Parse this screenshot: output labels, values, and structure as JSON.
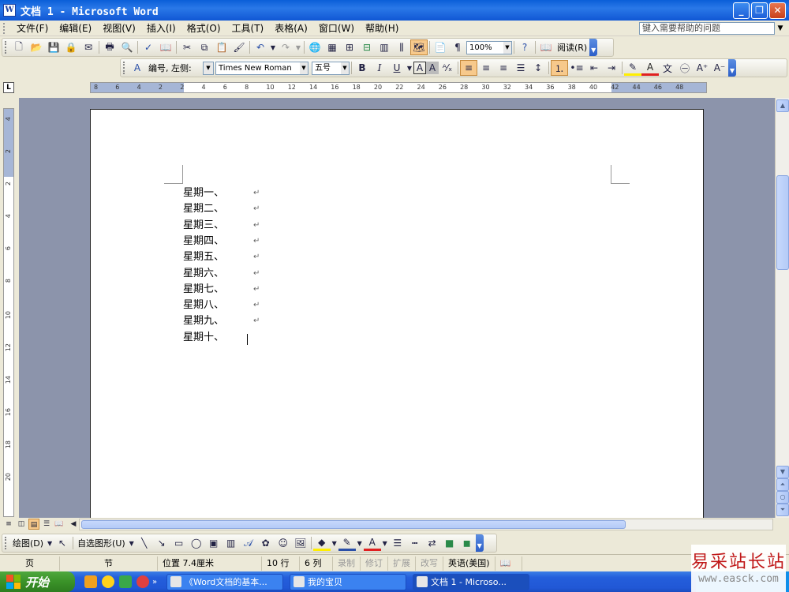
{
  "window": {
    "title": "文档 1 - Microsoft Word",
    "minimize": "_",
    "restore": "❐",
    "close": "✕"
  },
  "menu": {
    "items": [
      "文件(F)",
      "编辑(E)",
      "视图(V)",
      "插入(I)",
      "格式(O)",
      "工具(T)",
      "表格(A)",
      "窗口(W)",
      "帮助(H)"
    ],
    "help_placeholder": "键入需要帮助的问题"
  },
  "standard_toolbar": {
    "zoom": "100%",
    "read_label": "阅读(R)"
  },
  "format_toolbar": {
    "style": "编号, 左侧:",
    "font": "Times New Roman",
    "size": "五号"
  },
  "ruler": {
    "ticks": [
      "8",
      "6",
      "4",
      "2",
      "2",
      "4",
      "6",
      "8",
      "10",
      "12",
      "14",
      "16",
      "18",
      "20",
      "22",
      "24",
      "26",
      "28",
      "30",
      "32",
      "34",
      "36",
      "38",
      "40",
      "42",
      "44",
      "46",
      "48"
    ]
  },
  "vertical_ruler": {
    "ticks": [
      "4",
      "2",
      "2",
      "4",
      "6",
      "8",
      "10",
      "12",
      "14",
      "16",
      "18",
      "20"
    ]
  },
  "document": {
    "lines": [
      "星期一、",
      "星期二、",
      "星期三、",
      "星期四、",
      "星期五、",
      "星期六、",
      "星期七、",
      "星期八、",
      "星期九、",
      "星期十、"
    ],
    "paragraph_mark": "↵"
  },
  "drawing_toolbar": {
    "draw_label": "绘图(D)",
    "autoshape_label": "自选图形(U)"
  },
  "status": {
    "page": "页",
    "section": "节",
    "position": "位置 7.4厘米",
    "line": "10 行",
    "column": "6 列",
    "rec": "录制",
    "trk": "修订",
    "ext": "扩展",
    "ovr": "改写",
    "language": "英语(美国)"
  },
  "taskbar": {
    "start": "开始",
    "tasks": [
      "《Word文档的基本...",
      "我的宝贝",
      "文档 1 - Microso..."
    ]
  },
  "watermark": {
    "text": "易采站长站",
    "url": "www.easck.com"
  },
  "colors": {
    "titlebar": "#0a5fd8",
    "workspace": "#8c94ab",
    "taskbar": "#245edb",
    "start": "#3a9228"
  }
}
